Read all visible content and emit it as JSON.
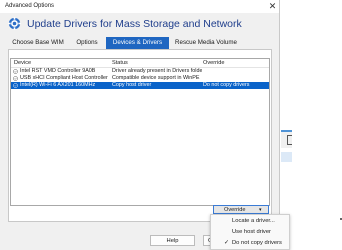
{
  "window": {
    "title": "Advanced Options",
    "close_glyph": "✕"
  },
  "header": {
    "title": "Update Drivers for Mass Storage and Network",
    "icon": "gear-icon"
  },
  "tabs": [
    {
      "label": "Choose Base WIM",
      "active": false
    },
    {
      "label": "Options",
      "active": false
    },
    {
      "label": "Devices & Drivers",
      "active": true
    },
    {
      "label": "Rescue Media Volume",
      "active": false
    }
  ],
  "table": {
    "headers": [
      "Device",
      "Status",
      "Override"
    ],
    "rows": [
      {
        "device": "Intel RST VMD Controller 9A0B",
        "status": "Driver already present in Drivers folder",
        "override": "",
        "selected": false
      },
      {
        "device": "USB xHCI Compliant Host Controller",
        "status": "Compatible device support in WinPE",
        "override": "",
        "selected": false
      },
      {
        "device": "Intel(R) Wi-Fi 6 AX201 160MHz",
        "status": "Copy host driver",
        "override": "Do not copy drivers",
        "selected": true
      }
    ]
  },
  "override_button": {
    "label": "Override",
    "caret": "▾"
  },
  "override_menu": {
    "items": [
      {
        "label": "Locate a driver...",
        "checked": false
      },
      {
        "label": "Use host driver",
        "checked": false
      },
      {
        "label": "Do not copy drivers",
        "checked": true
      }
    ],
    "check_glyph": "✓"
  },
  "footer": {
    "help_label": "Help",
    "ok_label": "O"
  },
  "colors": {
    "accent": "#1f66c1",
    "selection": "#0a63c9",
    "title_blue": "#1f3e8c"
  }
}
